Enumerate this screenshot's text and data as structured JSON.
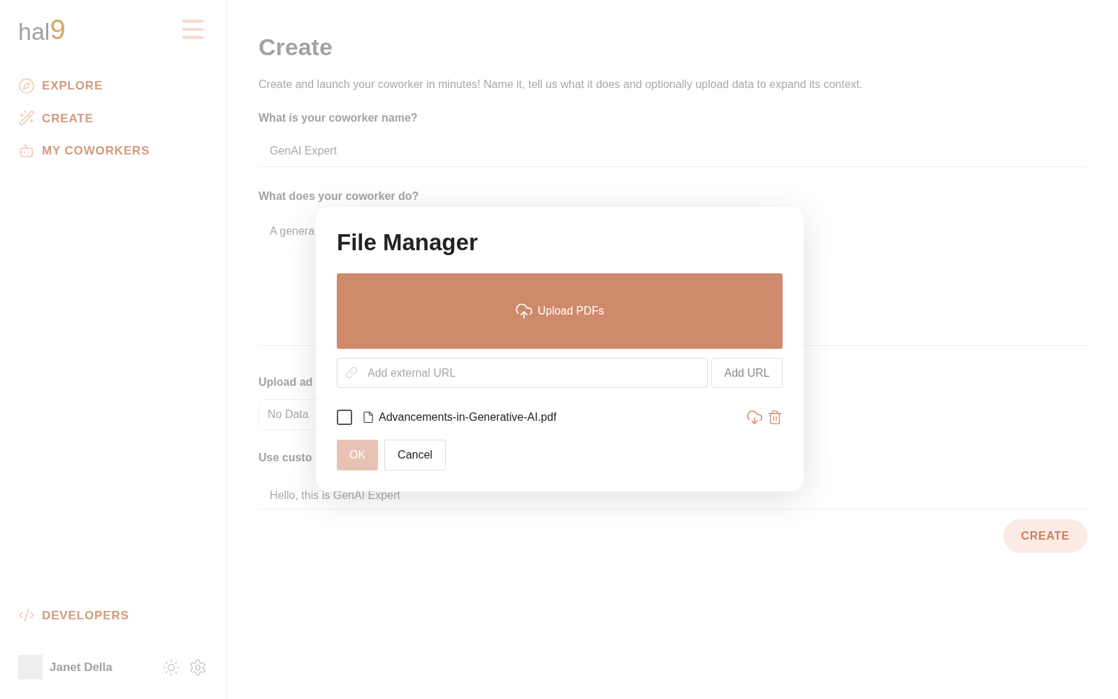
{
  "sidebar": {
    "logo": {
      "text": "hal",
      "mark": "9"
    },
    "nav": [
      {
        "label": "EXPLORE",
        "selected": false
      },
      {
        "label": "CREATE",
        "selected": false
      },
      {
        "label": "MY COWORKERS",
        "selected": false
      }
    ],
    "footer_link": "DEVELOPERS",
    "user": {
      "name": "Janet Della"
    }
  },
  "page": {
    "title": "Create",
    "description": "Create and launch your coworker in minutes! Name it, tell us what it does and optionally upload data to expand its context.",
    "name_label": "What is your coworker name?",
    "name_value": "GenAI Expert",
    "does_label": "What does your coworker do?",
    "does_value": "A genera",
    "upload_label": "Upload ad",
    "upload_value": "No Data",
    "custom_label": "Use custo",
    "custom_value": "Hello, this is GenAI Expert",
    "create_button": "CREATE"
  },
  "dialog": {
    "title": "File Manager",
    "upload_button": "Upload PDFs",
    "url_field": {
      "placeholder": "Add external URL"
    },
    "add_url_button": "Add URL",
    "files": [
      {
        "name": "Advancements-in-Generative-AI.pdf",
        "checked": false
      }
    ],
    "ok_button": {
      "label": "OK",
      "disabled": true
    },
    "cancel_button": "Cancel"
  }
}
